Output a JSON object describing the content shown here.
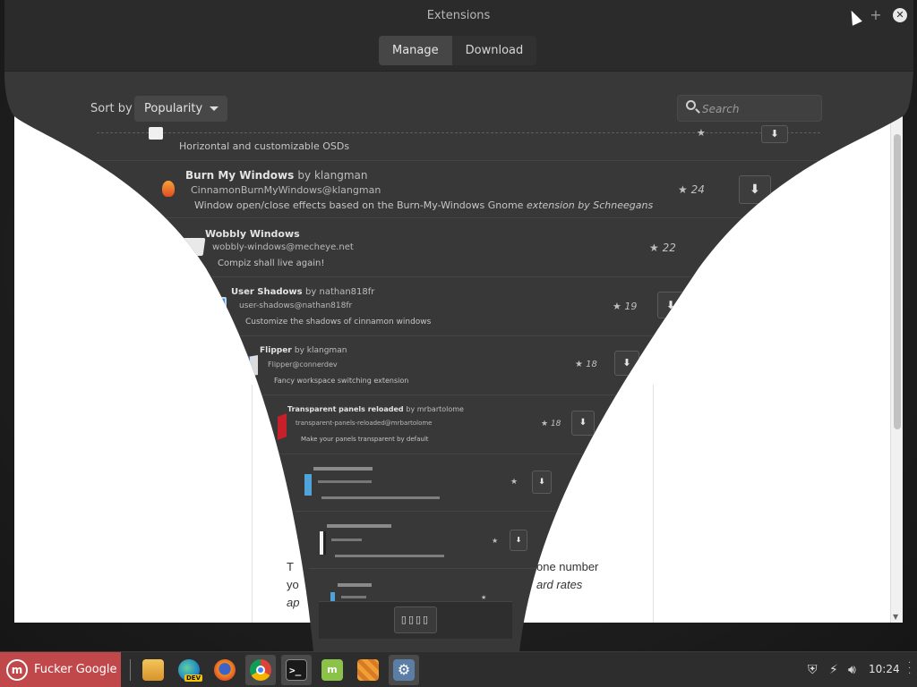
{
  "window": {
    "title": "Extensions"
  },
  "tabs": [
    {
      "label": "Manage",
      "active": true
    },
    {
      "label": "Download",
      "active": false
    }
  ],
  "toolbar": {
    "sort_label": "Sort by",
    "sort_value": "Popularity",
    "search_placeholder": "Search"
  },
  "extensions": [
    {
      "name": "",
      "author": "",
      "uuid": "",
      "description": "Horizontal and customizable OSDs",
      "stars": "",
      "installed": false,
      "icon": "osd-icon"
    },
    {
      "name": "Burn My Windows",
      "author": "by klangman",
      "uuid": "CinnamonBurnMyWindows@klangman",
      "description": "Window open/close effects based on the Burn-My-Windows Gnome",
      "description_em": "extension by Schneegans",
      "stars": "24",
      "installed": false,
      "icon": "flame-icon"
    },
    {
      "name": "Wobbly Windows",
      "author": "",
      "uuid": "wobbly-windows@mecheye.net",
      "description": "Compiz shall live again!",
      "stars": "22",
      "installed": true,
      "icon": "wobbly-window-icon"
    },
    {
      "name": "User Shadows",
      "author": "by nathan818fr",
      "uuid": "user-shadows@nathan818fr",
      "description": "Customize the shadows of cinnamon windows",
      "stars": "19",
      "installed": false,
      "icon": "shadow-window-icon"
    },
    {
      "name": "Flipper",
      "author": "by klangman",
      "uuid": "Flipper@connerdev",
      "description": "Fancy workspace switching extension",
      "stars": "18",
      "installed": false,
      "icon": "flipper-icon"
    },
    {
      "name": "Transparent panels reloaded",
      "author": "by mrbartolome",
      "uuid": "transparent-panels-reloaded@mrbartolome",
      "description": "Make your panels transparent by default",
      "stars": "18",
      "installed": false,
      "icon": "transparent-panel-icon"
    },
    {
      "name": "",
      "author": "",
      "uuid": "",
      "description": "",
      "stars": "",
      "installed": false,
      "icon": "extension-icon"
    },
    {
      "name": "",
      "author": "",
      "uuid": "",
      "description": "",
      "stars": "",
      "installed": false,
      "icon": "extension-icon"
    },
    {
      "name": "",
      "author": "",
      "uuid": "",
      "description": "",
      "stars": "",
      "installed": false,
      "icon": "extension-icon"
    }
  ],
  "background_page": {
    "left_text": [
      "T",
      "yo",
      "ap"
    ],
    "right_text": [
      "one number",
      "ard rates"
    ]
  },
  "taskbar": {
    "menu_label": "Fucker Google",
    "menu_logo": "m",
    "apps": [
      {
        "name": "files-icon"
      },
      {
        "name": "edge-dev-icon",
        "badge": "DEV"
      },
      {
        "name": "firefox-icon"
      },
      {
        "name": "chrome-icon"
      },
      {
        "name": "terminal-icon"
      },
      {
        "name": "mint-update-icon"
      },
      {
        "name": "orange-app-icon"
      },
      {
        "name": "settings-icon"
      }
    ],
    "clock": "10:24"
  },
  "colors": {
    "menu_accent": "#c0484b",
    "window_bg": "#383838"
  }
}
